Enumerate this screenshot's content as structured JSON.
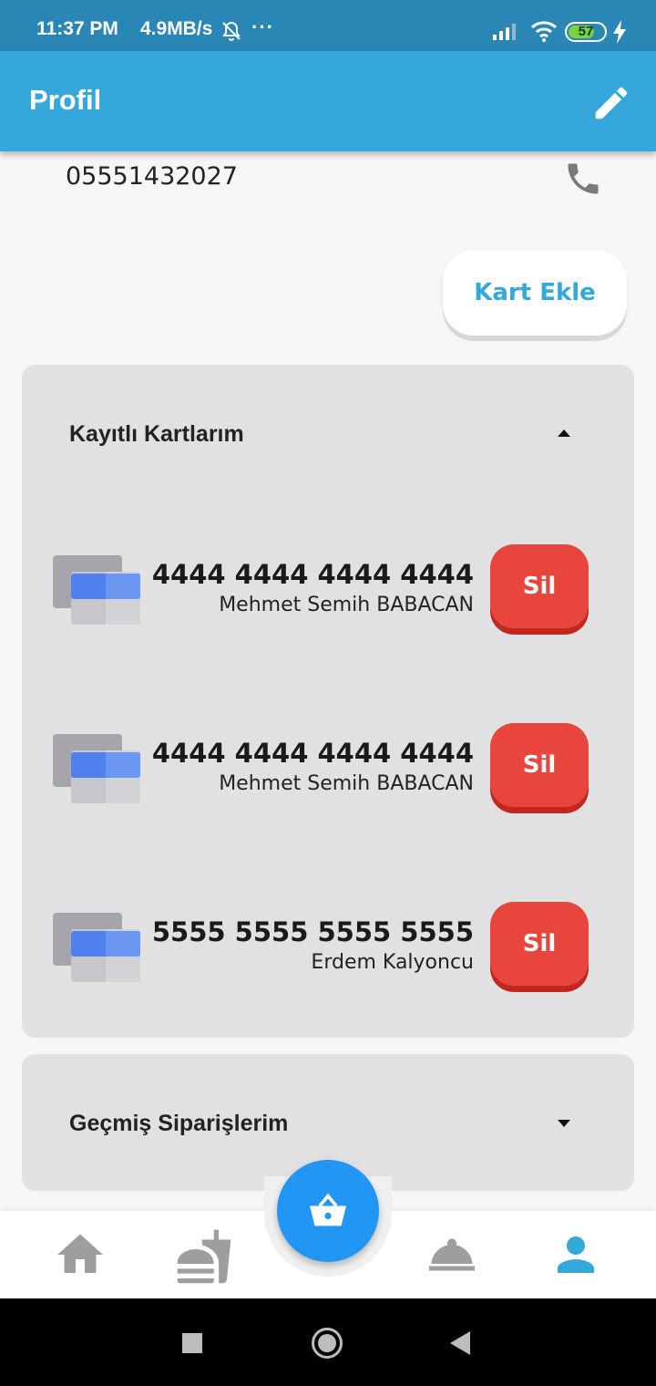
{
  "status_bar": {
    "time": "11:37 PM",
    "speed": "4.9MB/s",
    "more": "···",
    "battery": "57",
    "icons": [
      "bell-off-icon",
      "signal-icon",
      "wifi-icon",
      "battery-icon",
      "charging-icon"
    ]
  },
  "app_bar": {
    "title": "Profil",
    "edit_icon": "pencil-icon"
  },
  "contact": {
    "phone": "05551432027",
    "phone_icon": "phone-icon"
  },
  "add_card_label": "Kart Ekle",
  "saved_cards": {
    "title": "Kayıtlı Kartlarım",
    "expanded": true,
    "cards": [
      {
        "number": "4444 4444 4444 4444",
        "holder": "Mehmet Semih BABACAN",
        "delete_label": "Sil"
      },
      {
        "number": "4444 4444 4444 4444",
        "holder": "Mehmet Semih BABACAN",
        "delete_label": "Sil"
      },
      {
        "number": "5555 5555 5555 5555",
        "holder": "Erdem Kalyoncu",
        "delete_label": "Sil"
      }
    ]
  },
  "past_orders": {
    "title": "Geçmiş Siparişlerim",
    "expanded": false
  },
  "bottom_nav": {
    "items": [
      "home-icon",
      "fastfood-icon",
      "cart-icon",
      "room-service-icon",
      "person-icon"
    ],
    "active": "person-icon"
  },
  "colors": {
    "primary": "#35a7db",
    "status_bar": "#2a86b4",
    "danger": "#e8453c",
    "fab": "#2196f3"
  }
}
